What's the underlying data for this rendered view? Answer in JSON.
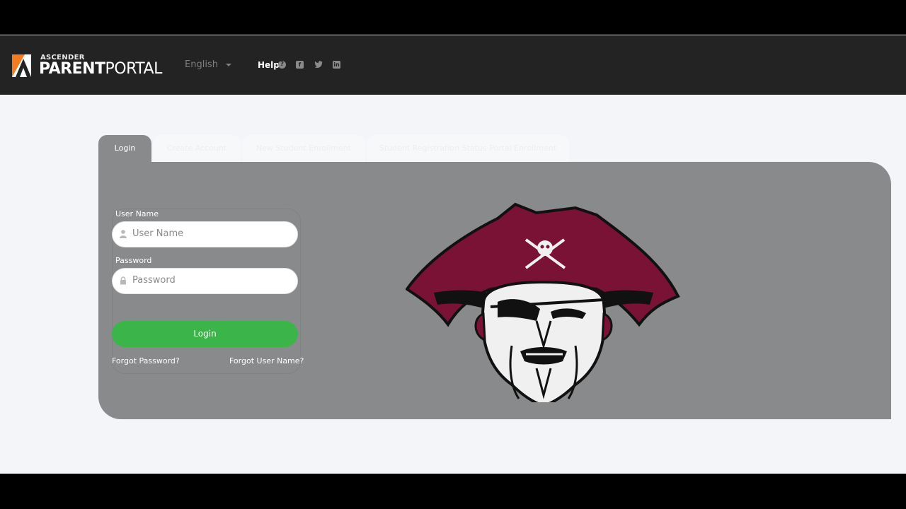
{
  "header": {
    "logo_small": "ASCENDER",
    "logo_bold": "PARENT",
    "logo_light": "PORTAL",
    "language": "English",
    "help_label": "Help",
    "social": [
      "facebook-icon",
      "twitter-icon",
      "linkedin-icon"
    ]
  },
  "tabs": [
    {
      "label": "Login",
      "active": true
    },
    {
      "label": "Create Account",
      "active": false
    },
    {
      "label": "New Student Enrollment",
      "active": false
    },
    {
      "label": "Student Registration Status Portal Enrollment",
      "active": false
    }
  ],
  "login_form": {
    "username_label": "User Name",
    "username_placeholder": "User Name",
    "password_label": "Password",
    "password_placeholder": "Password",
    "submit_label": "Login",
    "forgot_password": "Forgot Password?",
    "forgot_username": "Forgot User Name?"
  },
  "colors": {
    "header_bg": "#232323",
    "panel_bg": "#888a8c",
    "page_bg": "#f3f5f9",
    "login_button": "#3bb54a",
    "brand_orange": "#f47b20",
    "mascot_maroon": "#7a1235"
  },
  "mascot": {
    "name": "pirate-mascot"
  }
}
